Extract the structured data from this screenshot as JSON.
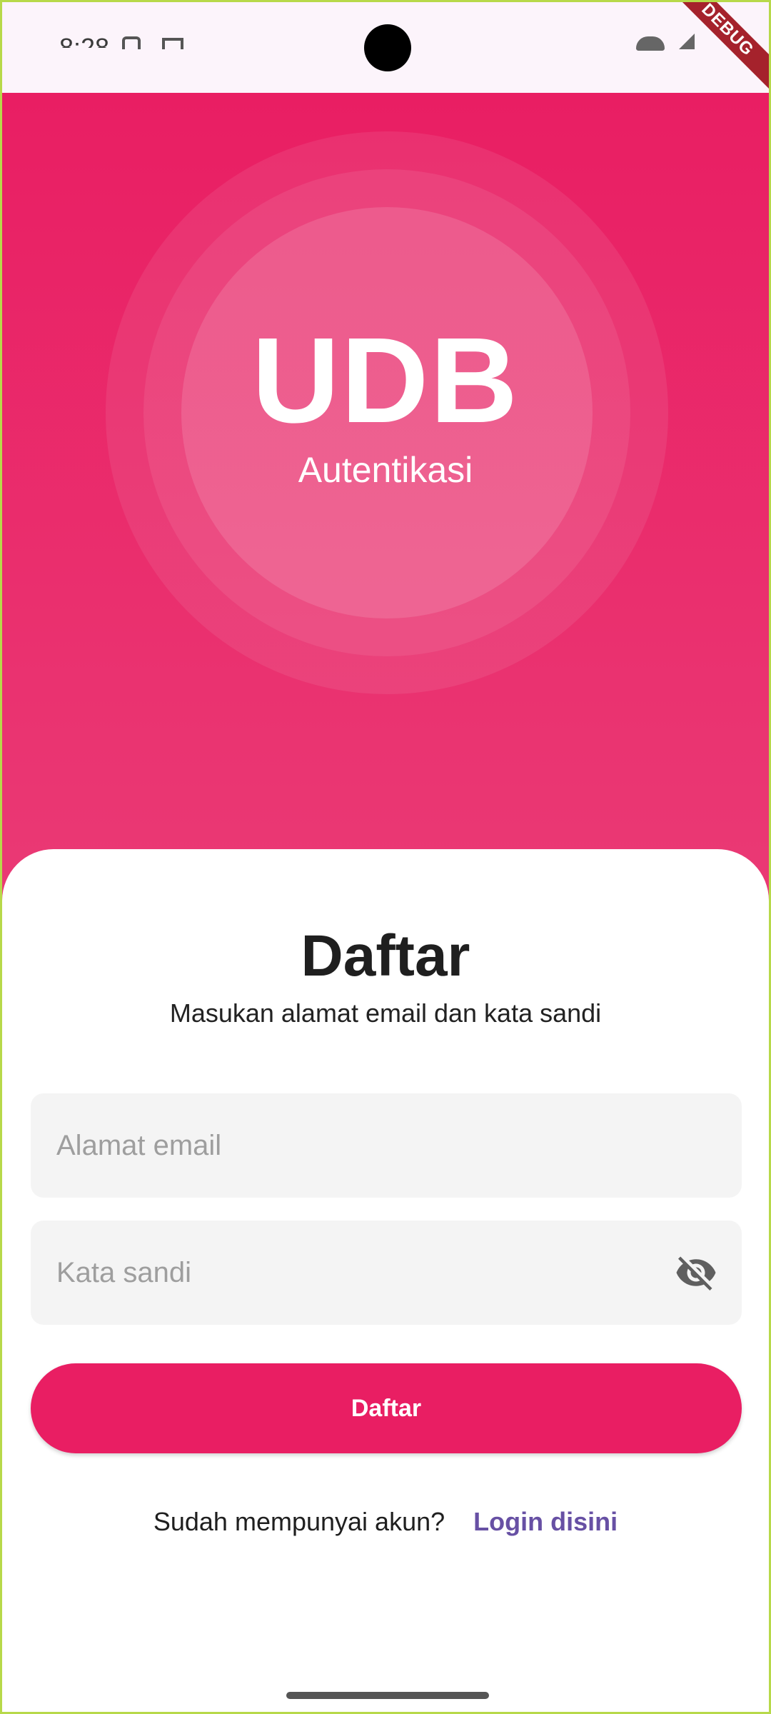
{
  "status_bar": {
    "time": "8:28"
  },
  "debug_banner": "DEBUG",
  "hero": {
    "logo": "UDB",
    "subtitle": "Autentikasi"
  },
  "form": {
    "title": "Daftar",
    "subtitle": "Masukan alamat email dan kata sandi",
    "email": {
      "placeholder": "Alamat email",
      "value": ""
    },
    "password": {
      "placeholder": "Kata sandi",
      "value": "",
      "toggle_icon": "eye-off-icon"
    },
    "submit_label": "Daftar",
    "login_prompt": "Sudah mempunyai akun?",
    "login_link": "Login disini"
  },
  "colors": {
    "primary": "#e91e63",
    "link": "#6750a4",
    "input_bg": "#f4f4f4"
  }
}
